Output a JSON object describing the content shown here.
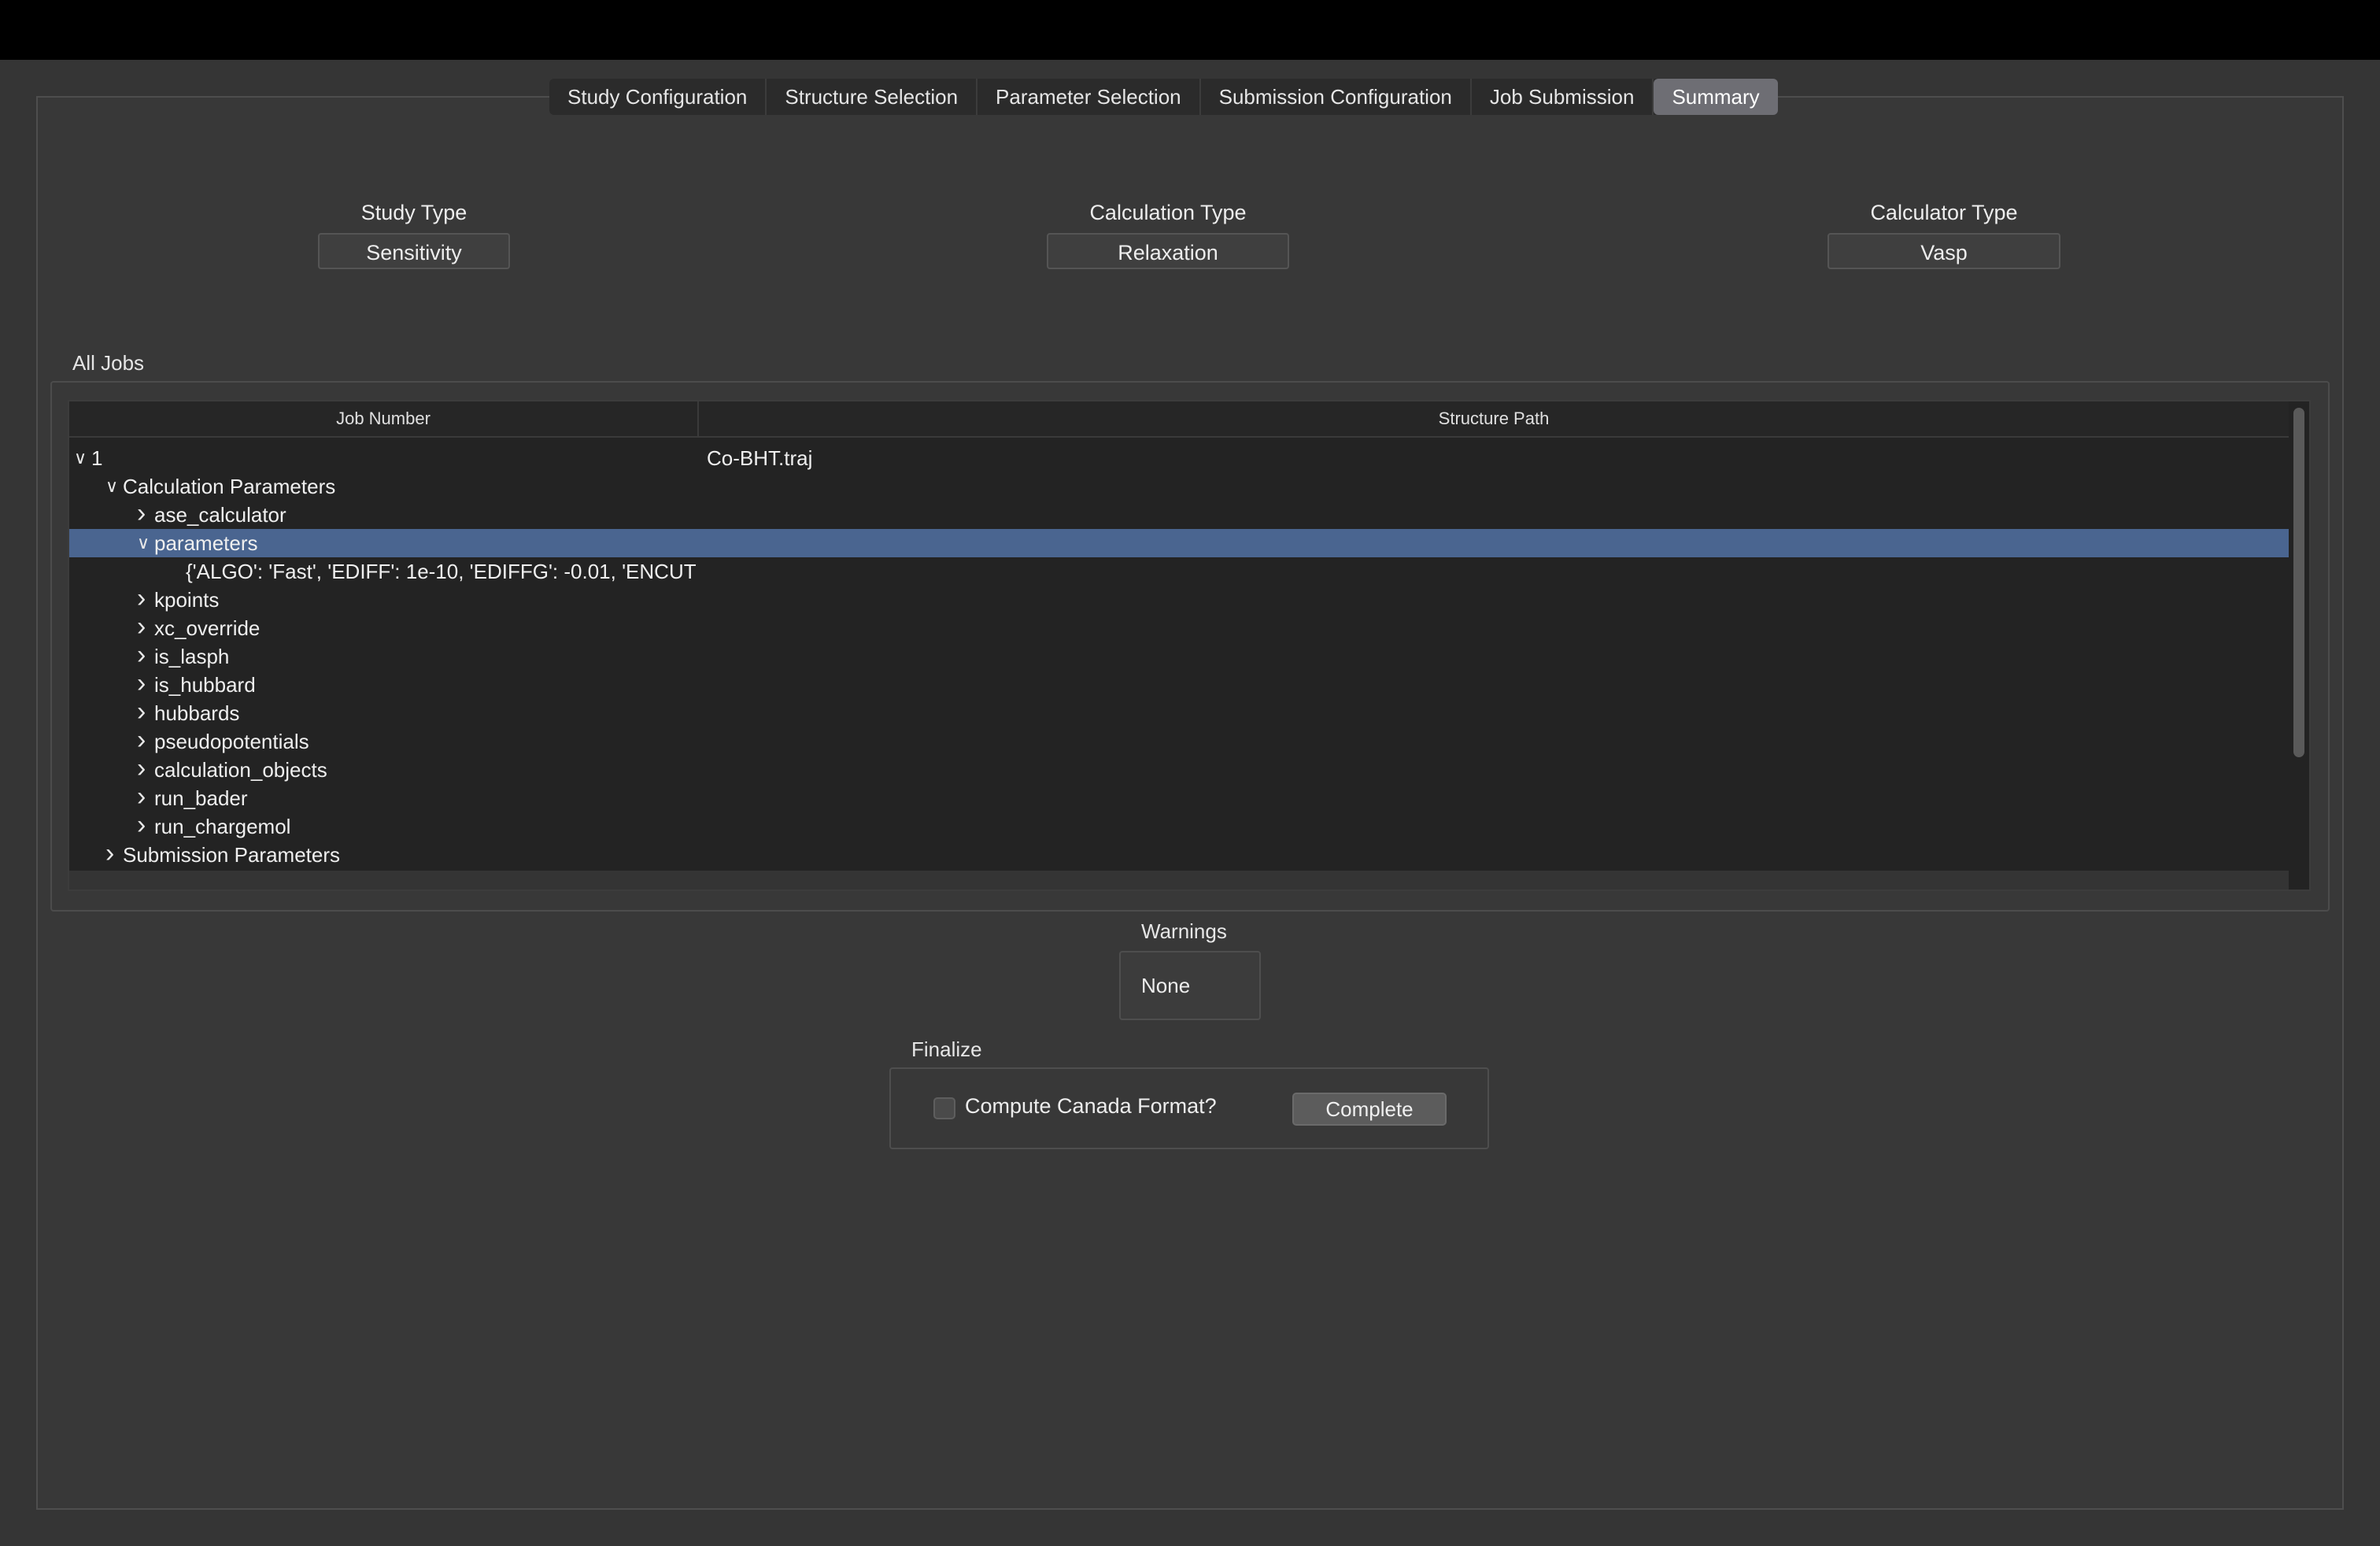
{
  "tabs": [
    {
      "label": "Study Configuration"
    },
    {
      "label": "Structure Selection"
    },
    {
      "label": "Parameter Selection"
    },
    {
      "label": "Submission Configuration"
    },
    {
      "label": "Job Submission"
    },
    {
      "label": "Summary",
      "active": true
    }
  ],
  "study_type": {
    "label": "Study Type",
    "value": "Sensitivity"
  },
  "calculation_type": {
    "label": "Calculation Type",
    "value": "Relaxation"
  },
  "calculator_type": {
    "label": "Calculator Type",
    "value": "Vasp"
  },
  "all_jobs": {
    "title": "All Jobs",
    "columns": [
      "Job Number",
      "Structure Path"
    ],
    "rows": [
      {
        "level": 0,
        "arrow": "expanded",
        "label": "1",
        "structure_path": "Co-BHT.traj"
      },
      {
        "level": 1,
        "arrow": "expanded",
        "label": "Calculation Parameters"
      },
      {
        "level": 2,
        "arrow": "collapsed",
        "label": "ase_calculator"
      },
      {
        "level": 2,
        "arrow": "expanded",
        "label": "parameters",
        "selected": true
      },
      {
        "level": 3,
        "arrow": "none",
        "label": "{'ALGO': 'Fast', 'EDIFF': 1e-10, 'EDIFFG': -0.01, 'ENCUT"
      },
      {
        "level": 2,
        "arrow": "collapsed",
        "label": "kpoints"
      },
      {
        "level": 2,
        "arrow": "collapsed",
        "label": "xc_override"
      },
      {
        "level": 2,
        "arrow": "collapsed",
        "label": "is_lasph"
      },
      {
        "level": 2,
        "arrow": "collapsed",
        "label": "is_hubbard"
      },
      {
        "level": 2,
        "arrow": "collapsed",
        "label": "hubbards"
      },
      {
        "level": 2,
        "arrow": "collapsed",
        "label": "pseudopotentials"
      },
      {
        "level": 2,
        "arrow": "collapsed",
        "label": "calculation_objects"
      },
      {
        "level": 2,
        "arrow": "collapsed",
        "label": "run_bader"
      },
      {
        "level": 2,
        "arrow": "collapsed",
        "label": "run_chargemol"
      },
      {
        "level": 1,
        "arrow": "collapsed",
        "label": "Submission Parameters"
      }
    ]
  },
  "warnings": {
    "label": "Warnings",
    "value": "None"
  },
  "finalize": {
    "label": "Finalize",
    "checkbox_label": "Compute Canada Format?",
    "checked": false,
    "complete_label": "Complete"
  },
  "colors": {
    "background": "#353535",
    "selection": "#4a6590",
    "active_tab": "#6e6e74"
  }
}
